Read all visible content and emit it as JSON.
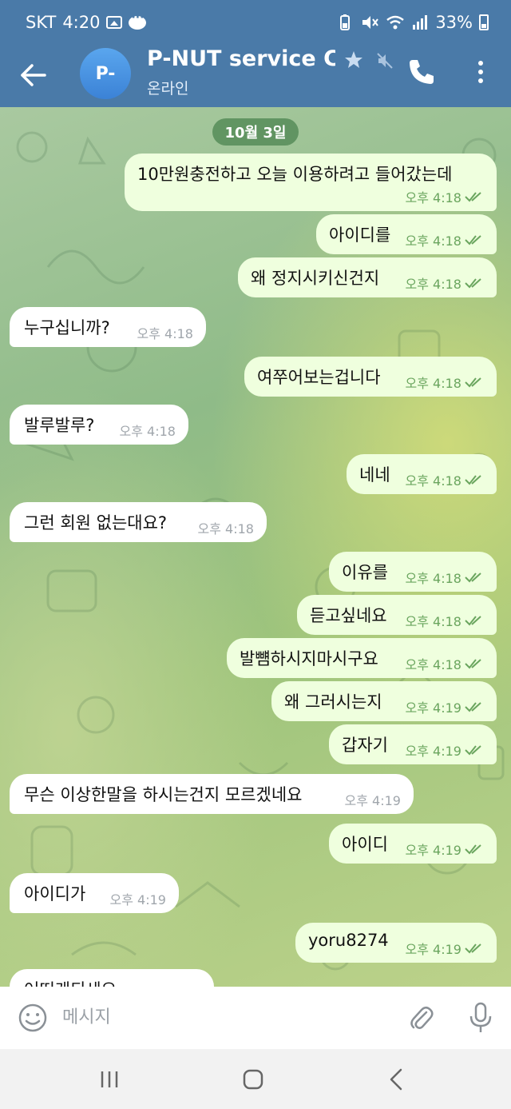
{
  "status_bar": {
    "carrier": "SKT",
    "time": "4:20",
    "battery": "33%"
  },
  "header": {
    "avatar_initials": "P-",
    "title": "P-NUT service Cen",
    "subtitle": "온라인"
  },
  "chat": {
    "date_chip": "10월 3일",
    "messages": [
      {
        "dir": "out",
        "text": "10만원충전하고 오늘 이용하려고 들어갔는데",
        "time": "오후 4:18"
      },
      {
        "dir": "out",
        "text": "아이디를",
        "time": "오후 4:18"
      },
      {
        "dir": "out",
        "text": "왜 정지시키신건지",
        "time": "오후 4:18"
      },
      {
        "dir": "in",
        "text": "누구십니까?",
        "time": "오후 4:18"
      },
      {
        "dir": "out",
        "text": "여쭈어보는겁니다",
        "time": "오후 4:18"
      },
      {
        "dir": "in",
        "text": "발루발루?",
        "time": "오후 4:18"
      },
      {
        "dir": "out",
        "text": "네네",
        "time": "오후 4:18"
      },
      {
        "dir": "in",
        "text": "그런 회원 없는대요?",
        "time": "오후 4:18"
      },
      {
        "dir": "out",
        "text": "이유를",
        "time": "오후 4:18"
      },
      {
        "dir": "out",
        "text": "듣고싶네요",
        "time": "오후 4:18"
      },
      {
        "dir": "out",
        "text": "발뻄하시지마시구요",
        "time": "오후 4:18"
      },
      {
        "dir": "out",
        "text": "왜 그러시는지",
        "time": "오후 4:19"
      },
      {
        "dir": "out",
        "text": "갑자기",
        "time": "오후 4:19"
      },
      {
        "dir": "in",
        "text": "무슨 이상한말을 하시는건지 모르겠네요",
        "time": "오후 4:19"
      },
      {
        "dir": "out",
        "text": "아이디",
        "time": "오후 4:19"
      },
      {
        "dir": "in",
        "text": "아이디가",
        "time": "오후 4:19"
      },
      {
        "dir": "out",
        "text": "yoru8274",
        "time": "오후 4:19"
      },
      {
        "dir": "in",
        "text": "어떠케되세요",
        "time": ""
      }
    ]
  },
  "input": {
    "placeholder": "메시지"
  },
  "colors": {
    "header_bg": "#4a7aa8",
    "outgoing_bubble": "#efffde",
    "incoming_bubble": "#ffffff",
    "check_color": "#6aa55e"
  },
  "icons": [
    "back-arrow-icon",
    "star-icon",
    "mute-icon",
    "phone-icon",
    "more-vert-icon",
    "emoji-icon",
    "attach-icon",
    "mic-icon"
  ]
}
